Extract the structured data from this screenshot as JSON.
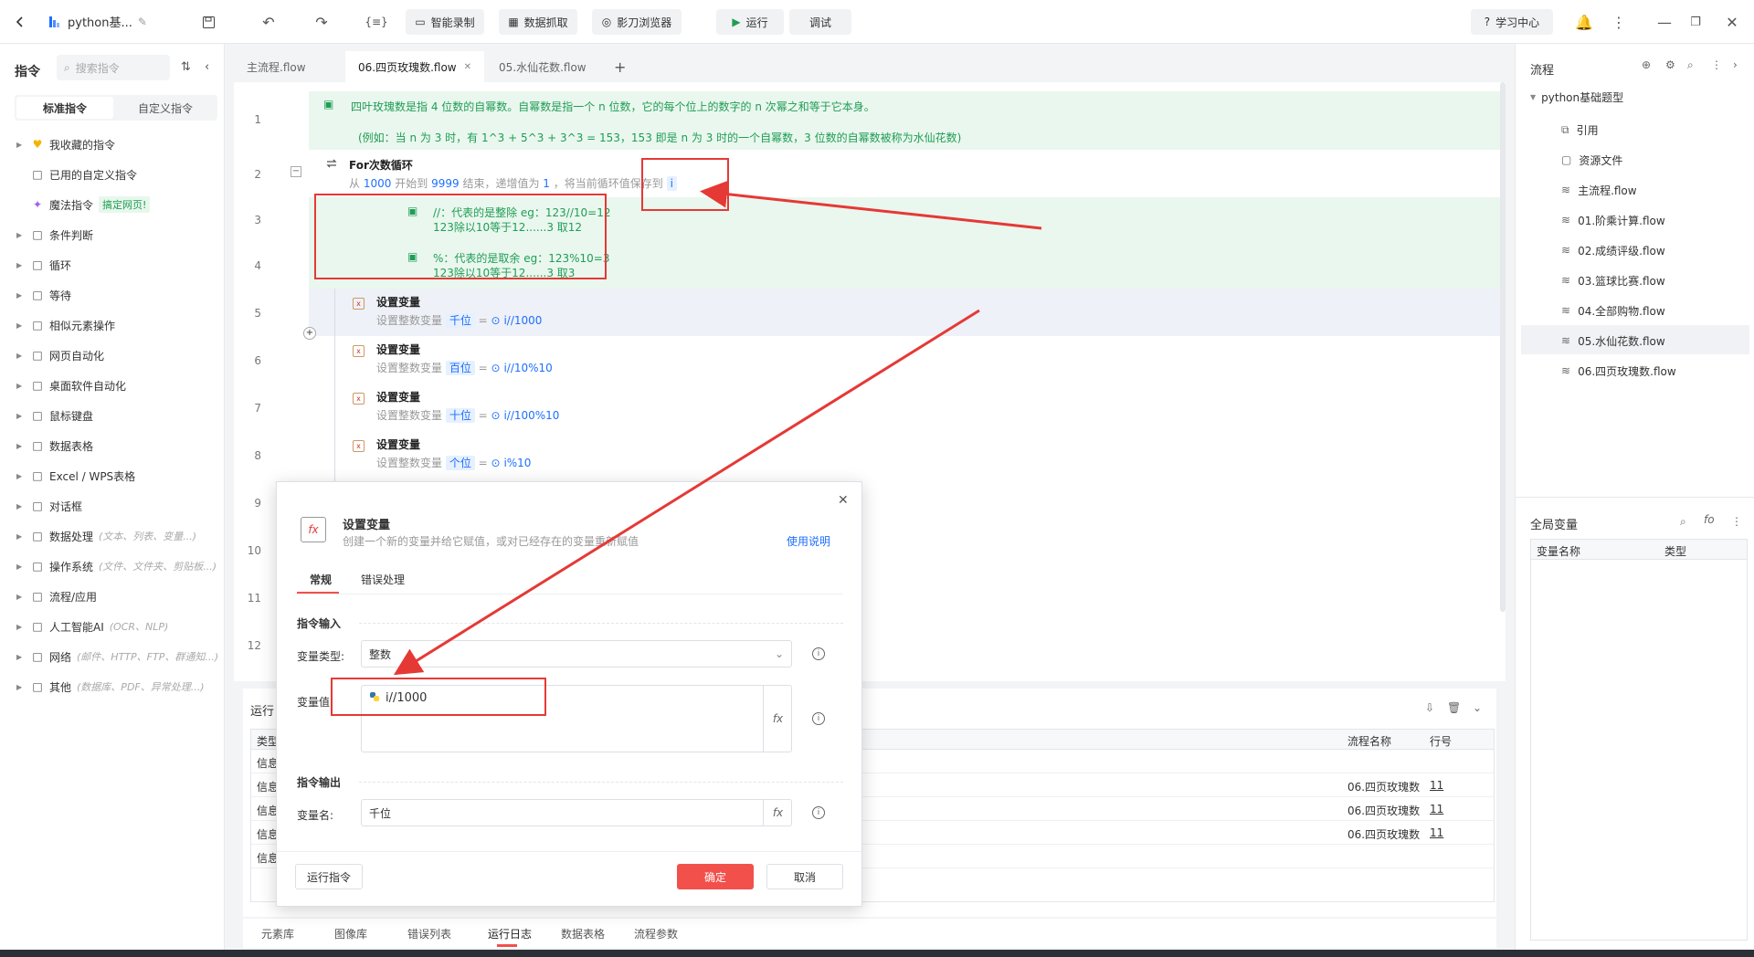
{
  "topbar": {
    "project_name": "python基...",
    "buttons": {
      "smart_record": "智能录制",
      "data_capture": "数据抓取",
      "browser": "影刀浏览器",
      "run": "运行",
      "debug": "调试",
      "learning_center": "学习中心"
    }
  },
  "left_panel": {
    "title": "指令",
    "search_placeholder": "搜索指令",
    "tabs": [
      "标准指令",
      "自定义指令"
    ],
    "items": [
      {
        "label": "我收藏的指令",
        "hint": "",
        "icon": "heart-icon",
        "expandable": true
      },
      {
        "label": "已用的自定义指令",
        "hint": "",
        "icon": "calendar-icon",
        "expandable": false
      },
      {
        "label": "魔法指令",
        "hint": "",
        "badge": "搞定网页!",
        "icon": "sparkle-icon",
        "expandable": false
      },
      {
        "label": "条件判断",
        "hint": "",
        "icon": "branch-icon",
        "expandable": true
      },
      {
        "label": "循环",
        "hint": "",
        "icon": "loop-icon",
        "expandable": true
      },
      {
        "label": "等待",
        "hint": "",
        "icon": "hourglass-icon",
        "expandable": true
      },
      {
        "label": "相似元素操作",
        "hint": "",
        "icon": "copy-icon",
        "expandable": true
      },
      {
        "label": "网页自动化",
        "hint": "",
        "icon": "globe-icon",
        "expandable": true
      },
      {
        "label": "桌面软件自动化",
        "hint": "",
        "icon": "monitor-icon",
        "expandable": true
      },
      {
        "label": "鼠标键盘",
        "hint": "",
        "icon": "mouse-icon",
        "expandable": true
      },
      {
        "label": "数据表格",
        "hint": "",
        "icon": "table-icon",
        "expandable": true
      },
      {
        "label": "Excel / WPS表格",
        "hint": "",
        "icon": "excel-icon",
        "expandable": true
      },
      {
        "label": "对话框",
        "hint": "",
        "icon": "dialog-icon",
        "expandable": true
      },
      {
        "label": "数据处理",
        "hint": "(文本、列表、变量...)",
        "icon": "data-icon",
        "expandable": true
      },
      {
        "label": "操作系统",
        "hint": "(文件、文件夹、剪贴板...)",
        "icon": "os-icon",
        "expandable": true
      },
      {
        "label": "流程/应用",
        "hint": "",
        "icon": "layers-icon",
        "expandable": true
      },
      {
        "label": "人工智能AI",
        "hint": "(OCR、NLP)",
        "icon": "ai-icon",
        "expandable": true
      },
      {
        "label": "网络",
        "hint": "(邮件、HTTP、FTP、群通知...)",
        "icon": "network-icon",
        "expandable": true
      },
      {
        "label": "其他",
        "hint": "(数据库、PDF、异常处理...)",
        "icon": "grid-icon",
        "expandable": true
      }
    ]
  },
  "editor_tabs": [
    "主流程.flow",
    "06.四页玫瑰数.flow",
    "05.水仙花数.flow"
  ],
  "editor": {
    "lines": [
      "1",
      "2",
      "3",
      "4",
      "5",
      "6",
      "7",
      "8",
      "9",
      "10",
      "11",
      "12"
    ],
    "comment1_line1": "四叶玫瑰数是指 4 位数的自幂数。自幂数是指一个 n 位数，它的每个位上的数字的 n 次幂之和等于它本身。",
    "comment1_line2": "(例如：当 n 为 3 时，有 1^3 + 5^3 + 3^3 = 153，153 即是 n 为 3 时的一个自幂数，3 位数的自幂数被称为水仙花数)",
    "loop_title": "For次数循环",
    "loop_desc_prefix": "从",
    "loop_start": "1000",
    "loop_desc_mid1": "开始到",
    "loop_end": "9999",
    "loop_desc_mid2": "结束，递增值为",
    "loop_step": "1",
    "loop_desc_mid3": "，将当前循环值保存到",
    "loop_var": "i",
    "comment2_a": "//：代表的是整除  eg：123//10=12",
    "comment2_b": "123除以10等于12......3  取12",
    "comment3_a": "%：代表的是取余  eg：123%10=3",
    "comment3_b": "123除以10等于12......3  取3",
    "set_var_title": "设置变量",
    "set_var_prefix": "设置整数变量",
    "set_vars": [
      {
        "name": "千位",
        "expr": "i//1000"
      },
      {
        "name": "百位",
        "expr": "i//10%10"
      },
      {
        "name": "十位",
        "expr": "i//100%10"
      },
      {
        "name": "个位",
        "expr": "i%10"
      }
    ]
  },
  "runlog": {
    "title": "运行",
    "col_type": "类型",
    "col_flow": "流程名称",
    "col_line": "行号",
    "rows": [
      {
        "type": "信息",
        "flow": "",
        "line": ""
      },
      {
        "type": "信息",
        "flow": "06.四页玫瑰数",
        "line": "11"
      },
      {
        "type": "信息",
        "flow": "06.四页玫瑰数",
        "line": "11"
      },
      {
        "type": "信息",
        "flow": "06.四页玫瑰数",
        "line": "11"
      },
      {
        "type": "信息",
        "flow": "",
        "line": ""
      }
    ]
  },
  "bottom_tabs": [
    "元素库",
    "图像库",
    "错误列表",
    "运行日志",
    "数据表格",
    "流程参数"
  ],
  "right_panel": {
    "title": "流程",
    "project": "python基础题型",
    "items": [
      "引用",
      "资源文件",
      "主流程.flow",
      "01.阶乘计算.flow",
      "02.成绩评级.flow",
      "03.篮球比赛.flow",
      "04.全部购物.flow",
      "05.水仙花数.flow",
      "06.四页玫瑰数.flow"
    ],
    "globals_title": "全局变量",
    "col_var_name": "变量名称",
    "col_var_type": "类型"
  },
  "modal": {
    "title": "设置变量",
    "subtitle": "创建一个新的变量并给它赋值，或对已经存在的变量重新赋值",
    "help_link": "使用说明",
    "tabs": [
      "常规",
      "错误处理"
    ],
    "section_input": "指令输入",
    "var_type_label": "变量类型:",
    "var_type_value": "整数",
    "var_value_label": "变量值:",
    "var_value": "i//1000",
    "section_output": "指令输出",
    "var_name_label": "变量名:",
    "var_name_value": "千位",
    "run_btn": "运行指令",
    "ok_btn": "确定",
    "cancel_btn": "取消",
    "fx": "fx"
  },
  "colors": {
    "accent": "#1e6fff",
    "comment_green": "#1f9d55",
    "comment_bg": "#eaf7ee",
    "danger": "#f2504b",
    "annotation_red": "#e53935"
  }
}
